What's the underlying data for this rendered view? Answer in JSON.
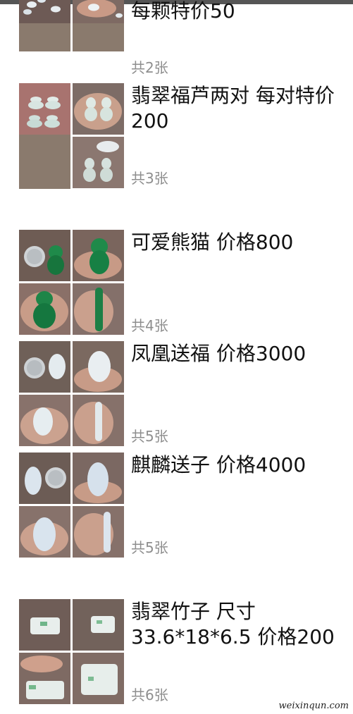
{
  "posts": [
    {
      "caption": "每颗特价50",
      "count": "共2张"
    },
    {
      "caption": "翡翠福芦两对 每对特价200",
      "count": "共3张"
    },
    {
      "caption": "可爱熊猫 价格800",
      "count": "共4张"
    },
    {
      "caption": "凤凰送福 价格3000",
      "count": "共5张"
    },
    {
      "caption": "麒麟送子 价格4000",
      "count": "共5张"
    },
    {
      "caption": "翡翠竹子 尺寸33.6*18*6.5 价格200",
      "count": "共6张"
    }
  ],
  "watermark": "weixinqun.com",
  "colors": {
    "jade_green": "#1f8a4a",
    "jade_ice": "#dfe8ee",
    "skin": "#c79a86",
    "wood": "#7a6a60",
    "count_gray": "#8e8e8e"
  }
}
